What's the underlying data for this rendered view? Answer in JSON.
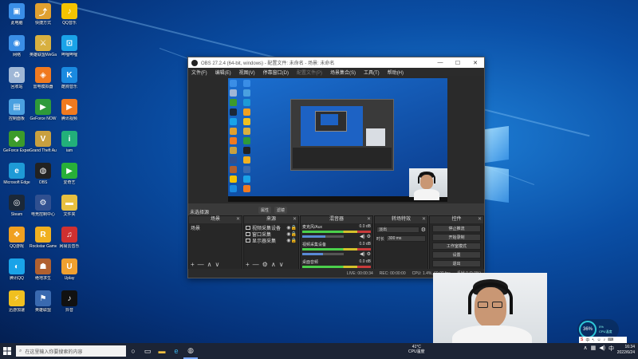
{
  "desktop": {
    "icons": [
      {
        "label": "此电脑",
        "color": "#3a8ee6",
        "glyph": "▣"
      },
      {
        "label": "网络",
        "color": "#3a8ee6",
        "glyph": "◉"
      },
      {
        "label": "回收站",
        "color": "#9fb7d6",
        "glyph": "♻"
      },
      {
        "label": "控制面板",
        "color": "#4aa0e0",
        "glyph": "▤"
      },
      {
        "label": "GeForce Experience",
        "color": "#3c9b2b",
        "glyph": "◆"
      },
      {
        "label": "Microsoft Edge",
        "color": "#1e9ad6",
        "glyph": "e"
      },
      {
        "label": "Steam",
        "color": "#1b2838",
        "glyph": "◎"
      },
      {
        "label": "QQ游戏",
        "color": "#f0a020",
        "glyph": "❖"
      },
      {
        "label": "腾讯QQ",
        "color": "#1aa3e8",
        "glyph": "◐"
      },
      {
        "label": "迅游加速",
        "color": "#f0c020",
        "glyph": "⚡"
      },
      {
        "label": "快捷方式",
        "color": "#e0a030",
        "glyph": "⤴"
      },
      {
        "label": "英雄联盟WeGame",
        "color": "#d8b040",
        "glyph": "⚔"
      },
      {
        "label": "雷电模拟器",
        "color": "#f07a20",
        "glyph": "◈"
      },
      {
        "label": "GeForce NOW",
        "color": "#2e9a3a",
        "glyph": "▶"
      },
      {
        "label": "Grand Theft Auto V",
        "color": "#c8a040",
        "glyph": "V"
      },
      {
        "label": "OBS",
        "color": "#222222",
        "glyph": "◍"
      },
      {
        "label": "电竞控制中心",
        "color": "#305090",
        "glyph": "⚙"
      },
      {
        "label": "Rockstar Games",
        "color": "#f0b020",
        "glyph": "R"
      },
      {
        "label": "绝地求生",
        "color": "#b06030",
        "glyph": "☗"
      },
      {
        "label": "英雄联盟",
        "color": "#3a6ab0",
        "glyph": "⚑"
      },
      {
        "label": "QQ音乐",
        "color": "#f5c400",
        "glyph": "♪"
      },
      {
        "label": "哔哩哔哩",
        "color": "#1aa3e8",
        "glyph": "⊡"
      },
      {
        "label": "酷狗音乐",
        "color": "#1a8ae0",
        "glyph": "K"
      },
      {
        "label": "腾讯视频",
        "color": "#f07a20",
        "glyph": "▶"
      },
      {
        "label": "iam",
        "color": "#22b07a",
        "glyph": "i"
      },
      {
        "label": "爱奇艺",
        "color": "#28b038",
        "glyph": "▶"
      },
      {
        "label": "文件夹",
        "color": "#e8c040",
        "glyph": "▬"
      },
      {
        "label": "网易云音乐",
        "color": "#d03030",
        "glyph": "♫"
      },
      {
        "label": "Uplay",
        "color": "#f0a030",
        "glyph": "U"
      },
      {
        "label": "抖音",
        "color": "#111111",
        "glyph": "♪"
      }
    ]
  },
  "obs": {
    "title": "OBS 27.2.4 (64-bit, windows) - 配置文件: 未命名 - 场景: 未命名",
    "menu": [
      "文件(F)",
      "编辑(E)",
      "视图(V)",
      "停靠窗口(D)",
      "配置文件(P)",
      "场景集合(S)",
      "工具(T)",
      "帮助(H)"
    ],
    "no_source": "未选择源",
    "preview_buttons": [
      "属性",
      "滤镜"
    ],
    "docks": {
      "scenes": {
        "header": "场景",
        "items": [
          "场景"
        ]
      },
      "sources": {
        "header": "来源",
        "items": [
          "视频采集设备",
          "窗口采集",
          "显示器采集"
        ]
      },
      "mixer": {
        "header": "混音器",
        "rows": [
          {
            "name": "麦克风/Aux",
            "db": "0.0 dB",
            "level": 0.55
          },
          {
            "name": "视频采集设备",
            "db": "0.0 dB",
            "level": 0.5
          },
          {
            "name": "桌面音频",
            "db": "0.0 dB",
            "level": 0.0
          }
        ]
      },
      "transitions": {
        "header": "转场特效",
        "type": "淡出",
        "duration_label": "时长",
        "duration": "300 ms"
      },
      "controls": {
        "header": "控件",
        "buttons": [
          "停止推流",
          "开始录制",
          "工作室模式",
          "设置",
          "退出"
        ]
      }
    },
    "status": {
      "live": "LIVE: 00:00:34",
      "rec": "REC: 00:00:00",
      "cpu": "CPU: 1.4%, 60.00 fps",
      "dropped": "丢帧 0 (0.0%)"
    }
  },
  "perf": {
    "cpu_pct": "36%",
    "line1": "0%",
    "line2": "CPU温度"
  },
  "taskbar": {
    "search_placeholder": "在这里输入你要搜索的内容",
    "weather_temp": "41°C",
    "weather_label": "CPU温度",
    "time": "16:34",
    "date": "2022/6/24"
  }
}
